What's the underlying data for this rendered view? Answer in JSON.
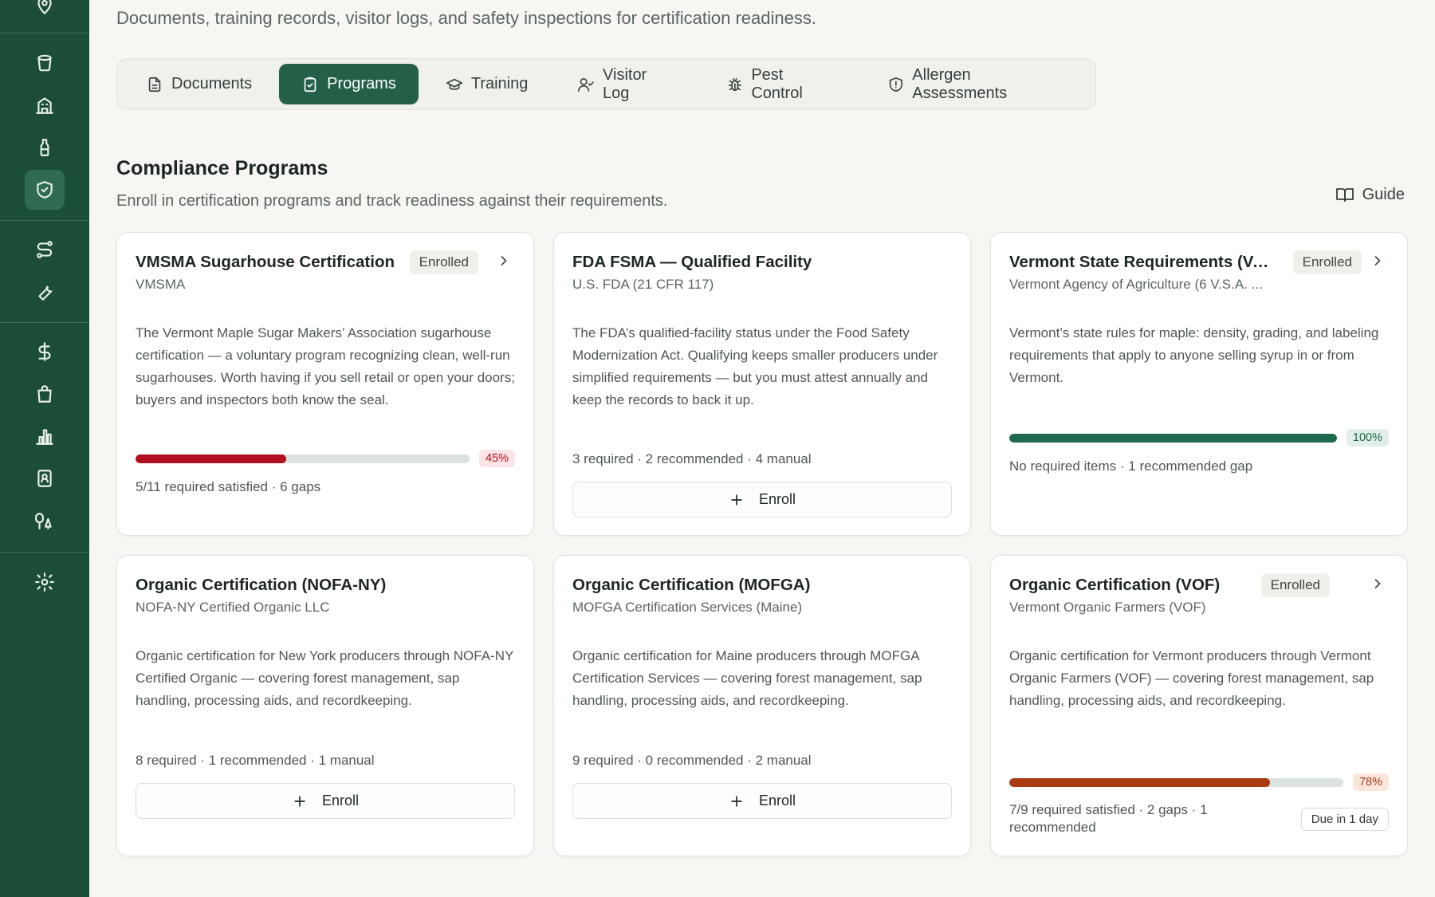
{
  "colors": {
    "sidebar": "#1b4d39",
    "accent": "#246048",
    "danger": "#b0101f",
    "success": "#1f6a4d",
    "warning": "#a83b0f"
  },
  "sidebar": {
    "items": [
      {
        "icon": "map-pin-icon"
      },
      {
        "icon": "bucket-icon"
      },
      {
        "icon": "building-icon"
      },
      {
        "icon": "bottle-icon"
      },
      {
        "icon": "shield-icon",
        "active": true
      },
      {
        "icon": "route-icon"
      },
      {
        "icon": "wrench-icon"
      },
      {
        "icon": "dollar-icon"
      },
      {
        "icon": "shopping-bag-icon"
      },
      {
        "icon": "bar-chart-icon"
      },
      {
        "icon": "contacts-book-icon"
      },
      {
        "icon": "trees-icon"
      },
      {
        "icon": "gear-icon"
      }
    ]
  },
  "header": {
    "subtitle": "Documents, training records, visitor logs, and safety inspections for certification readiness."
  },
  "tabs": [
    {
      "label": "Documents",
      "icon": "file-icon"
    },
    {
      "label": "Programs",
      "icon": "clipboard-check-icon",
      "active": true
    },
    {
      "label": "Training",
      "icon": "graduation-cap-icon"
    },
    {
      "label": "Visitor Log",
      "icon": "user-check-icon"
    },
    {
      "label": "Pest Control",
      "icon": "bug-icon"
    },
    {
      "label": "Allergen Assessments",
      "icon": "shield-alert-icon"
    }
  ],
  "section": {
    "title": "Compliance Programs",
    "subtitle": "Enroll in certification programs and track readiness against their requirements.",
    "guide_label": "Guide"
  },
  "cards": [
    {
      "title": "VMSMA Sugarhouse Certification",
      "org": "VMSMA",
      "badge": "Enrolled",
      "description": "The Vermont Maple Sugar Makers’ Association sugarhouse certification — a voluntary program recognizing clean, well-run sugarhouses. Worth having if you sell retail or open your doors; buyers and inspectors both know the seal.",
      "progress": 45,
      "progress_label": "45%",
      "meta": "5/11 required satisfied · 6 gaps"
    },
    {
      "title": "FDA FSMA — Qualified Facility",
      "org": "U.S. FDA (21 CFR 117)",
      "description": "The FDA’s qualified-facility status under the Food Safety Modernization Act. Qualifying keeps smaller producers under simplified requirements — but you must attest annually and keep the records to back it up.",
      "meta": "3 required · 2 recommended · 4 manual",
      "enroll_label": "Enroll"
    },
    {
      "title": "Vermont State Requirements (VA...",
      "org": "Vermont Agency of Agriculture (6 V.S.A. ...",
      "badge": "Enrolled",
      "description": "Vermont’s state rules for maple: density, grading, and labeling requirements that apply to anyone selling syrup in or from Vermont.",
      "progress": 100,
      "progress_label": "100%",
      "meta": "No required items · 1 recommended gap"
    },
    {
      "title": "Organic Certification (NOFA-NY)",
      "org": "NOFA-NY Certified Organic LLC",
      "description": "Organic certification for New York producers through NOFA-NY Certified Organic — covering forest management, sap handling, processing aids, and recordkeeping.",
      "meta": "8 required · 1 recommended · 1 manual",
      "enroll_label": "Enroll"
    },
    {
      "title": "Organic Certification (MOFGA)",
      "org": "MOFGA Certification Services (Maine)",
      "description": "Organic certification for Maine producers through MOFGA Certification Services — covering forest management, sap handling, processing aids, and recordkeeping.",
      "meta": "9 required · 0 recommended · 2 manual",
      "enroll_label": "Enroll"
    },
    {
      "title": "Organic Certification (VOF)",
      "org": "Vermont Organic Farmers (VOF)",
      "badge": "Enrolled",
      "description": "Organic certification for Vermont producers through Vermont Organic Farmers (VOF) — covering forest management, sap handling, processing aids, and recordkeeping.",
      "progress": 78,
      "progress_label": "78%",
      "meta": "7/9 required satisfied · 2 gaps · 1 recommended",
      "due_label": "Due in 1 day"
    }
  ]
}
